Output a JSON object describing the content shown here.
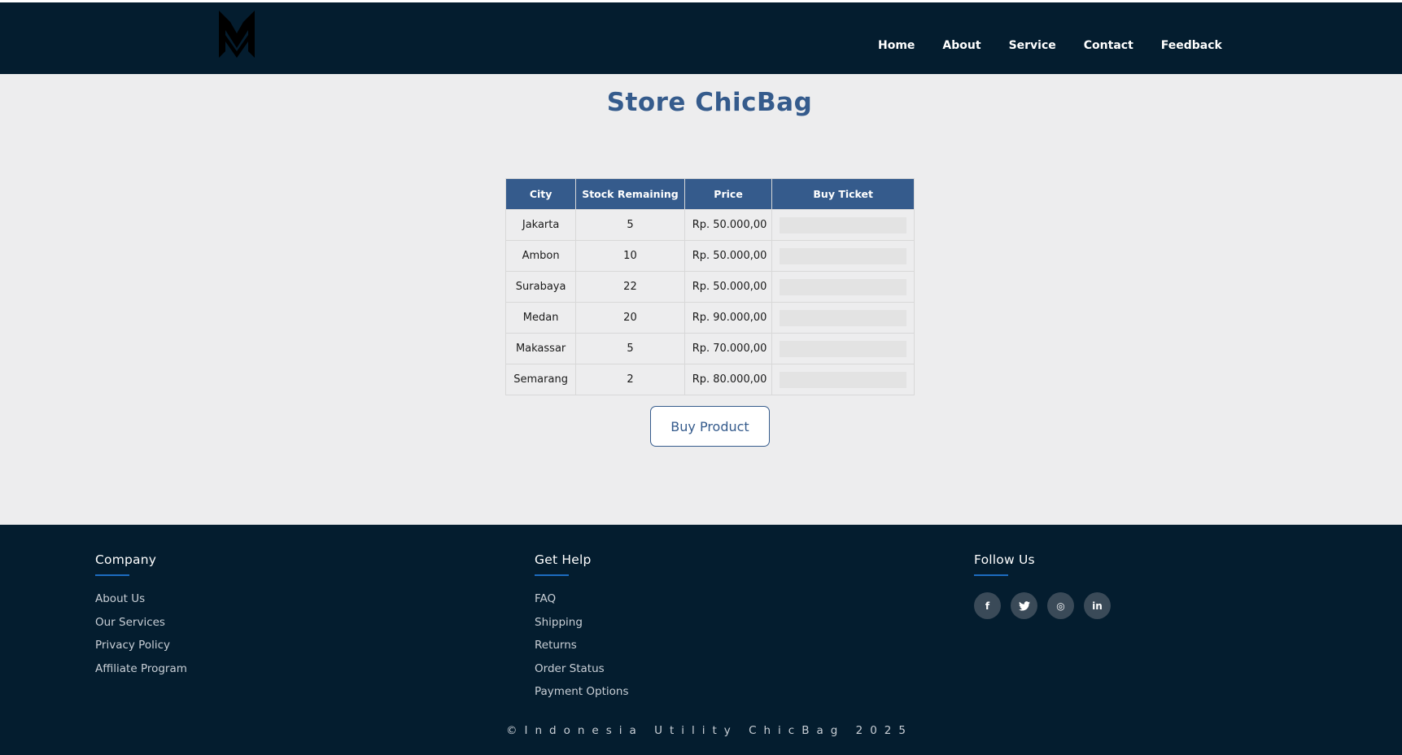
{
  "nav": {
    "items": [
      "Home",
      "About",
      "Service",
      "Contact",
      "Feedback"
    ]
  },
  "page": {
    "title": "Store ChicBag"
  },
  "table": {
    "headers": [
      "City",
      "Stock Remaining",
      "Price",
      "Buy Ticket"
    ],
    "rows": [
      {
        "city": "Jakarta",
        "stock": "5",
        "price": "Rp. 50.000,00"
      },
      {
        "city": "Ambon",
        "stock": "10",
        "price": "Rp. 50.000,00"
      },
      {
        "city": "Surabaya",
        "stock": "22",
        "price": "Rp. 50.000,00"
      },
      {
        "city": "Medan",
        "stock": "20",
        "price": "Rp. 90.000,00"
      },
      {
        "city": "Makassar",
        "stock": "5",
        "price": "Rp. 70.000,00"
      },
      {
        "city": "Semarang",
        "stock": "2",
        "price": "Rp. 80.000,00"
      }
    ]
  },
  "buy_button": {
    "label": "Buy Product"
  },
  "footer": {
    "company": {
      "title": "Company",
      "links": [
        "About Us",
        "Our Services",
        "Privacy Policy",
        "Affiliate Program"
      ]
    },
    "help": {
      "title": "Get Help",
      "links": [
        "FAQ",
        "Shipping",
        "Returns",
        "Order Status",
        "Payment Options"
      ]
    },
    "follow": {
      "title": "Follow Us",
      "icons": [
        {
          "name": "facebook-icon",
          "glyph": "f"
        },
        {
          "name": "twitter-icon",
          "glyph": "t"
        },
        {
          "name": "instagram-icon",
          "glyph": "◎"
        },
        {
          "name": "linkedin-icon",
          "glyph": "in"
        }
      ]
    },
    "copyright": "©Indonesia Utility ChicBag 2025"
  },
  "colors": {
    "header_bg": "#041d2f",
    "accent": "#355b8c",
    "underline": "#1d6cc0",
    "page_bg": "#ededee"
  }
}
